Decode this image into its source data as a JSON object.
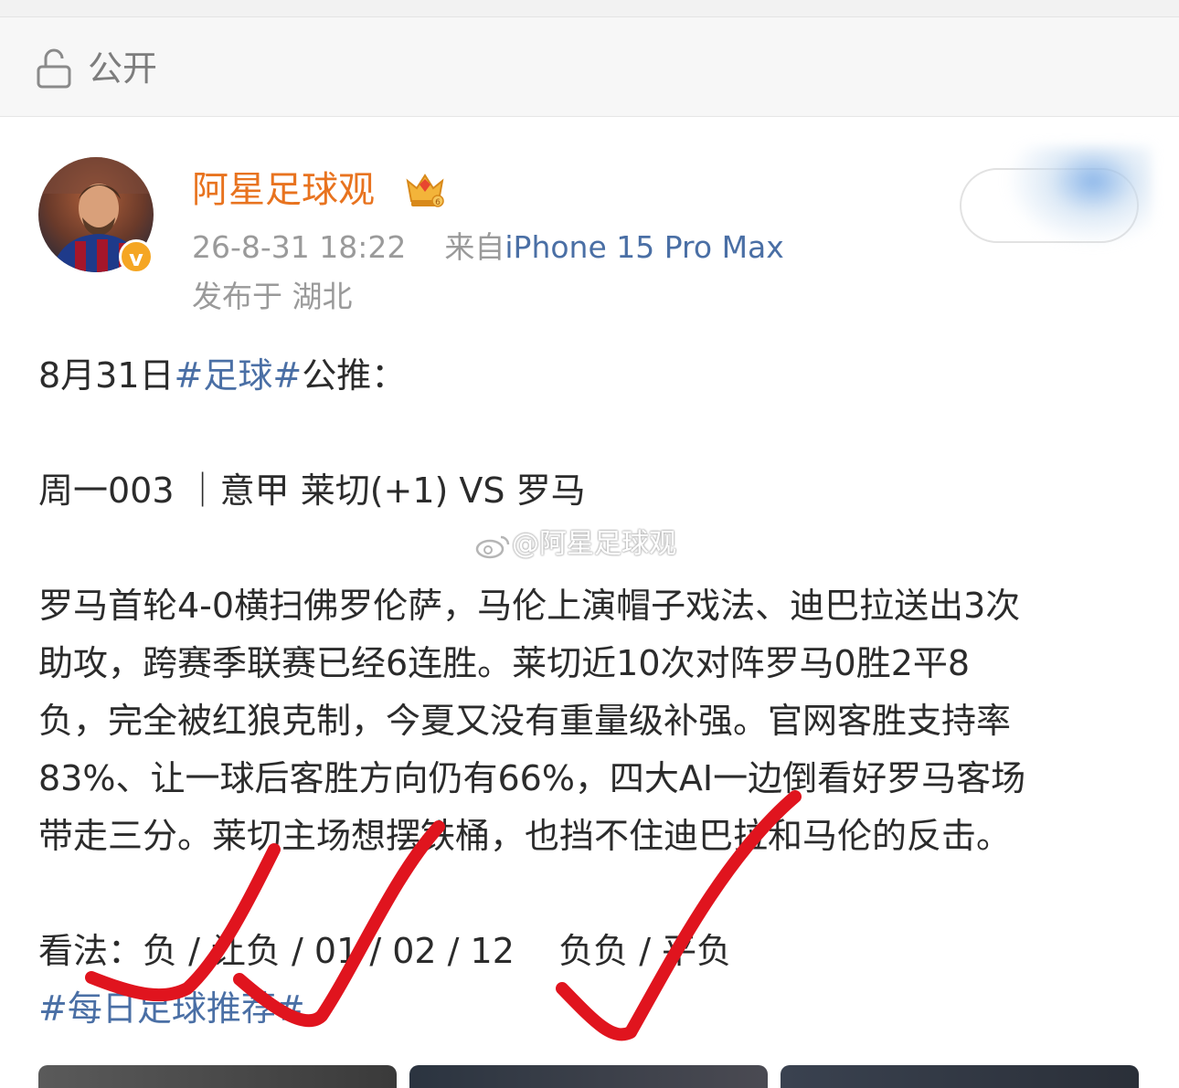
{
  "visibility": {
    "label": "公开",
    "icon": "lock-open-icon"
  },
  "author": {
    "name": "阿星足球观",
    "badge_icon": "crown-icon",
    "verified_icon": "verified-icon",
    "verified_symbol": "v"
  },
  "meta": {
    "time": "26-8-31 18:22",
    "from_label": "来自",
    "device": "iPhone 15 Pro Max",
    "location": "发布于 湖北"
  },
  "post": {
    "intro_prefix": "8月31日",
    "intro_hashtag": "#足球#",
    "intro_suffix": "公推：",
    "match": "周一003 ｜意甲 莱切(+1) VS 罗马",
    "analysis_lines": [
      "罗马首轮4-0横扫佛罗伦萨，马伦上演帽子戏法、迪巴拉送出3次",
      "助攻，跨赛季联赛已经6连胜。莱切近10次对阵罗马0胜2平8",
      "负，完全被红狼克制，今夏又没有重量级补强。官网客胜支持率",
      "83%、让一球后客胜方向仍有66%，四大AI一边倒看好罗马客场",
      "带走三分。莱切主场想摆铁桶，也挡不住迪巴拉和马伦的反击。"
    ],
    "prediction": "看法：负 / 让负 / 01 / 02 / 12    负负 / 平负",
    "footer_hashtag": "#每日足球推荐#"
  },
  "watermark": "@阿星足球观",
  "colors": {
    "accent_orange": "#e8731f",
    "link_blue": "#4a6fa5",
    "meta_gray": "#9a9a9a",
    "check_red": "#e0141e"
  }
}
